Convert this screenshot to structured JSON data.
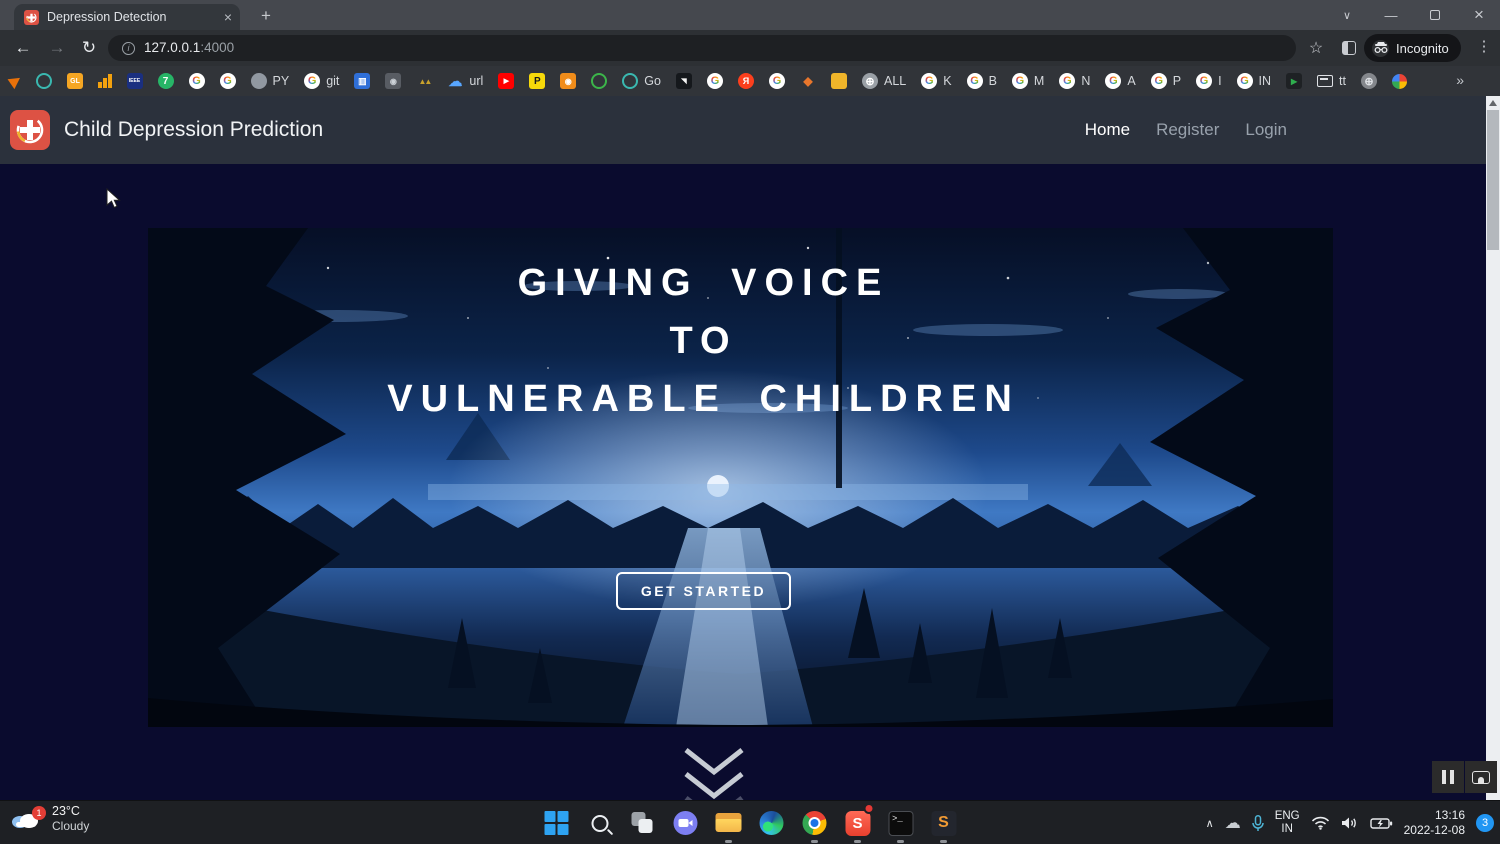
{
  "browser": {
    "tab_title": "Depression Detection",
    "close_tab": "×",
    "new_tab": "+",
    "window_controls": {
      "tab_search": "∨",
      "minimize": "—",
      "close": "×"
    },
    "toolbar": {
      "back": "←",
      "forward": "→",
      "reload": "↻",
      "info": "i",
      "star": "☆",
      "menu": "⋮"
    },
    "address": {
      "host": "127.0.0.1",
      "port": ":4000"
    },
    "incognito_label": "Incognito",
    "bookmarks_overflow": "»"
  },
  "bookmarks": [
    {
      "shape": "kite",
      "color": "#e8710a"
    },
    {
      "shape": "ring",
      "color": "#3ab8b0"
    },
    {
      "shape": "square",
      "color": "#f5a623",
      "text": "GL",
      "textColor": "#ffffff",
      "fs": 7
    },
    {
      "shape": "bars",
      "color": "#f4a20e"
    },
    {
      "shape": "square",
      "color": "#1a2f80",
      "text": "IEEE",
      "textColor": "#ffffff",
      "fs": 5
    },
    {
      "shape": "circle",
      "color": "#27b567",
      "text": "7",
      "textColor": "#ffffff",
      "fs": 10
    },
    {
      "shape": "g"
    },
    {
      "shape": "g"
    },
    {
      "shape": "circle",
      "color": "#9198a1",
      "label": "PY"
    },
    {
      "shape": "g",
      "label": "git"
    },
    {
      "shape": "square",
      "color": "#2f6fd8",
      "text": "▥",
      "textColor": "#ffffff",
      "fs": 9
    },
    {
      "shape": "square",
      "color": "#585c63",
      "text": "◉",
      "textColor": "#cdd2d8",
      "fs": 8
    },
    {
      "shape": "glyph",
      "glyph": "▲▲",
      "color": "#c9a22c",
      "fs": 8,
      "ls": "-2px"
    },
    {
      "shape": "glyph",
      "glyph": "☁",
      "color": "#58a6ff",
      "fs": 14,
      "label": "url"
    },
    {
      "shape": "square",
      "color": "#ff0000",
      "text": "▶",
      "textColor": "#ffffff",
      "fs": 7
    },
    {
      "shape": "square",
      "color": "#f7d90a",
      "text": "P",
      "textColor": "#1a1a1a",
      "fs": 10
    },
    {
      "shape": "square",
      "color": "#f08c1a",
      "text": "◉",
      "textColor": "#ffffff",
      "fs": 8
    },
    {
      "shape": "ring",
      "color": "#3cb54a"
    },
    {
      "shape": "ring",
      "color": "#3ab8b0",
      "label": "Go"
    },
    {
      "shape": "square",
      "color": "#15181c",
      "text": "◥",
      "textColor": "#f5f5f5",
      "fs": 7
    },
    {
      "shape": "g"
    },
    {
      "shape": "circle",
      "color": "#fc3f1d",
      "text": "Я",
      "textColor": "#ffffff",
      "fs": 9
    },
    {
      "shape": "g"
    },
    {
      "shape": "glyph",
      "glyph": "◆",
      "color": "#e8762c",
      "fs": 12
    },
    {
      "shape": "square",
      "color": "#f0b52a",
      "text": "",
      "fs": 8
    },
    {
      "shape": "circle",
      "color": "#9aa0a6",
      "text": "⊕",
      "textColor": "#ffffff",
      "fs": 11,
      "label": "ALL"
    },
    {
      "shape": "g",
      "label": "K"
    },
    {
      "shape": "g",
      "label": "B"
    },
    {
      "shape": "g",
      "label": "M"
    },
    {
      "shape": "g",
      "label": "N"
    },
    {
      "shape": "g",
      "label": "A"
    },
    {
      "shape": "g",
      "label": "P"
    },
    {
      "shape": "g",
      "label": "I"
    },
    {
      "shape": "g",
      "label": "IN"
    },
    {
      "shape": "square",
      "color": "#1e2124",
      "text": "▶",
      "textColor": "#2fae4e",
      "fs": 8
    },
    {
      "shape": "monitor",
      "label": "tt"
    },
    {
      "shape": "circle",
      "color": "#84878c",
      "text": "⊕",
      "textColor": "#dfe2e6",
      "fs": 11
    },
    {
      "shape": "pinwheel"
    }
  ],
  "page": {
    "brand": "Child Depression Prediction",
    "nav": [
      {
        "label": "Home",
        "active": true
      },
      {
        "label": "Register",
        "active": false
      },
      {
        "label": "Login",
        "active": false
      }
    ],
    "hero": {
      "line1": "GIVING VOICE",
      "line2": "TO",
      "line3": "VULNERABLE CHILDREN",
      "cta": "GET STARTED"
    }
  },
  "taskbar": {
    "weather": {
      "badge": "1",
      "temp": "23°C",
      "condition": "Cloudy"
    },
    "apps": [
      {
        "name": "start",
        "open": false
      },
      {
        "name": "search",
        "open": false
      },
      {
        "name": "taskview",
        "open": false
      },
      {
        "name": "chat",
        "open": false
      },
      {
        "name": "explorer",
        "open": true
      },
      {
        "name": "edge",
        "open": false
      },
      {
        "name": "chrome",
        "open": true
      },
      {
        "name": "s-app",
        "open": true,
        "badge": true
      },
      {
        "name": "terminal",
        "open": true
      },
      {
        "name": "sublime",
        "open": true,
        "label": "S"
      }
    ],
    "tray": {
      "chevron": "∧",
      "cloud": "☁",
      "lang_top": "ENG",
      "lang_bottom": "IN",
      "time": "13:16",
      "date": "2022-12-08",
      "badge": "3"
    }
  },
  "colors": {
    "accent_red": "#dd5244",
    "page_bg": "#0a0b2e",
    "header_bg": "#2b313c",
    "taskbar_bg": "#1e2024",
    "badge_blue": "#2196f3",
    "hero_sky": "#3f79c4"
  }
}
